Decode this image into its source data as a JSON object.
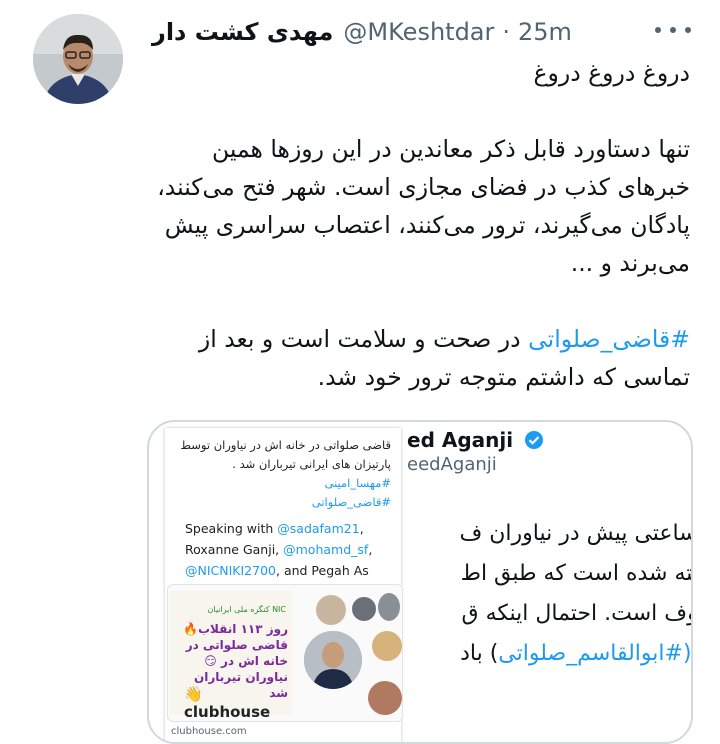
{
  "tweet": {
    "display_name": "مهدی کشت دار",
    "handle": "@MKeshtdar",
    "separator": "·",
    "time": "25m",
    "paragraph1": "دروغ دروغ دروغ",
    "paragraph2": "تنها دستاورد قابل ذکر معاندین در این روزها همین خبرهای کذب در فضای مجازی است. شهر فتح می‌کنند، پادگان می‌گیرند، ترور می‌کنند، اعتصاب سراسری پیش می‌برند و ...",
    "hashtag": "#قاضی_صلواتی",
    "paragraph3_rest": " در صحت و سلامت است و بعد از تماسی که داشتم متوجه ترور خود شد."
  },
  "embedded": {
    "name": "ed Aganji",
    "handle": "eedAganji",
    "lines": [
      "ها ساعتی پیش در نیاوران ف",
      "کشته شده است که طبق اط",
      "عروف است. احتمال اینکه ق"
    ],
    "last_line_prefix": "تی (",
    "last_line_hashtag": "#ابوالقاسم_صلواتی",
    "last_line_suffix": ") باد"
  },
  "overlay": {
    "fa_line1": "قاضی صلواتی در خانه اش در نیاوران توسط",
    "fa_line2": "پارتیزان های ایرانی تیرباران  شد .",
    "hashtag1": "#مهسا_امینی",
    "hashtag2": "#قاضی_صلواتی",
    "en_prefix": "Speaking with ",
    "mention1": "@sadafam21",
    "en_mid1": ", Roxanne Ganji, ",
    "mention2": "@mohamd_sf",
    "en_mid2": ", ",
    "mention3": "@NICNIKI2700",
    "en_suffix": ", and Pegah As",
    "card_org": "NIC کنگره ملی ایرانیان",
    "card_headline": "روز ۱۱۳ انقلاب🔥قاضی صلواتی در خانه اش در 😏نیاوران تیرباران شد",
    "card_logo": "👋 clubhouse",
    "card_domain": "clubhouse.com"
  },
  "colors": {
    "link": "#1d9bf0",
    "text": "#0f1419",
    "muted": "#536471",
    "border": "#cfd9de"
  }
}
